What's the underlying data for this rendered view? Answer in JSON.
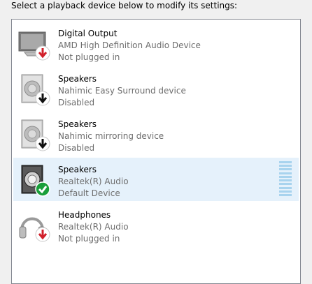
{
  "instruction": "Select a playback device below to modify its settings:",
  "devices": [
    {
      "name": "Digital Output",
      "description": "AMD High Definition Audio Device",
      "status": "Not plugged in",
      "icon": "monitor-icon",
      "badge": "not-plugged-in-badge",
      "selected": false
    },
    {
      "name": "Speakers",
      "description": "Nahimic Easy Surround device",
      "status": "Disabled",
      "icon": "speaker-icon",
      "badge": "disabled-badge",
      "selected": false
    },
    {
      "name": "Speakers",
      "description": "Nahimic mirroring device",
      "status": "Disabled",
      "icon": "speaker-icon",
      "badge": "disabled-badge",
      "selected": false
    },
    {
      "name": "Speakers",
      "description": "Realtek(R) Audio",
      "status": "Default Device",
      "icon": "speaker-icon",
      "badge": "default-device-check-badge",
      "selected": true,
      "level": 0
    },
    {
      "name": "Headphones",
      "description": "Realtek(R) Audio",
      "status": "Not plugged in",
      "icon": "headphones-icon",
      "badge": "not-plugged-in-badge",
      "selected": false
    }
  ],
  "colors": {
    "selection": "#e5f1fb",
    "meter": "#a8d3ee",
    "badge_red": "#d1202a",
    "badge_green": "#1a9f3a",
    "secondary_text": "#6d6d6d"
  }
}
